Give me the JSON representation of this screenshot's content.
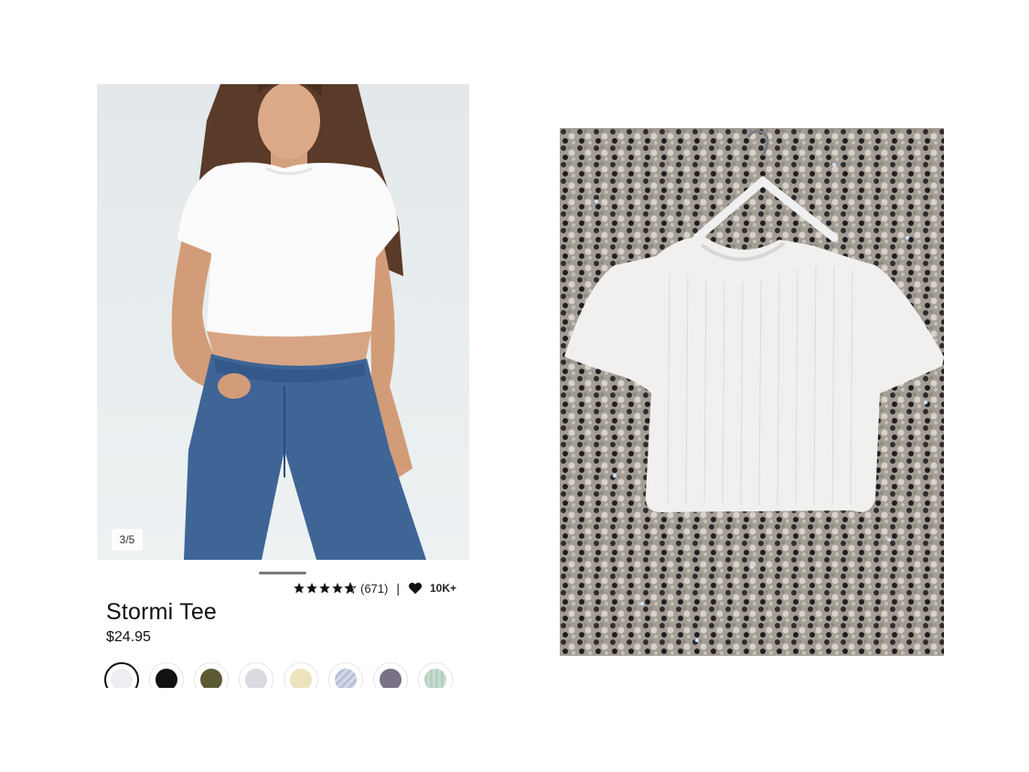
{
  "product": {
    "photo_counter": "3/5",
    "rating_count": "(671)",
    "separator": "|",
    "likes": "10K+",
    "title": "Stormi Tee",
    "price": "$24.95",
    "rating_stars": 4.5
  },
  "icons": {
    "star": "star-icon",
    "heart": "heart-icon"
  },
  "colors": {
    "swatch_white": "#eceef4",
    "swatch_black": "#111111",
    "swatch_olive": "#5b5a32",
    "swatch_grey": "#d9dbe0",
    "swatch_cream": "#ece3bd",
    "swatch_blue_stripe": "#b8c0d9",
    "swatch_purple": "#7a7184",
    "swatch_mint": "#b6cfc0"
  }
}
